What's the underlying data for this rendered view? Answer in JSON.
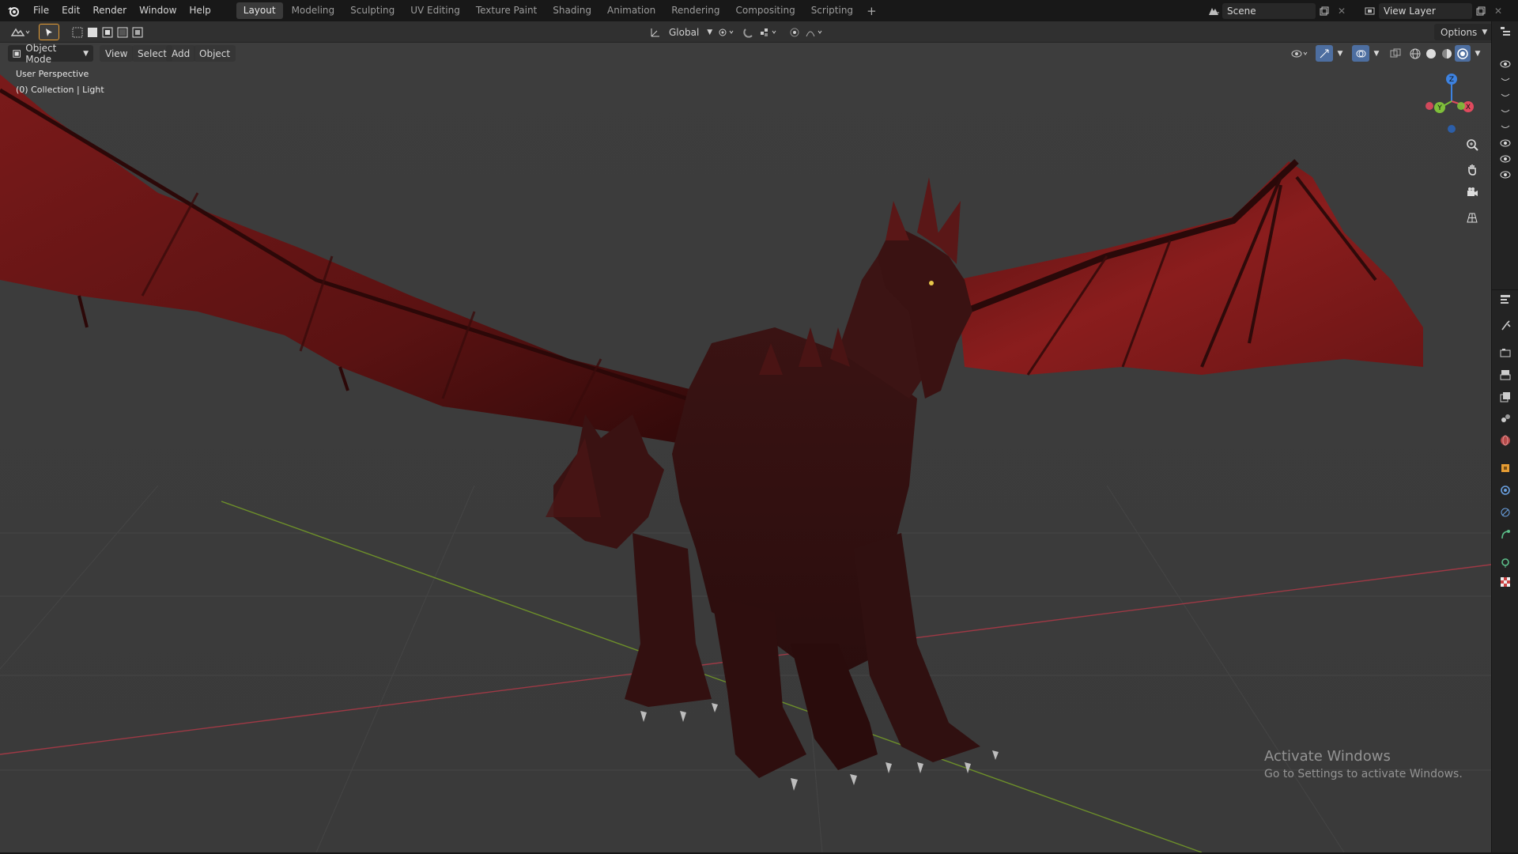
{
  "menu": [
    "File",
    "Edit",
    "Render",
    "Window",
    "Help"
  ],
  "workspaces": [
    "Layout",
    "Modeling",
    "Sculpting",
    "UV Editing",
    "Texture Paint",
    "Shading",
    "Animation",
    "Rendering",
    "Compositing",
    "Scripting"
  ],
  "active_workspace": "Layout",
  "add_workspace_label": "+",
  "scene": {
    "name": "Scene"
  },
  "view_layer": {
    "name": "View Layer"
  },
  "tool_header": {
    "transform_orientation": "Global",
    "options_label": "Options"
  },
  "viewport": {
    "mode": "Object Mode",
    "menus": [
      "View",
      "Select",
      "Add",
      "Object"
    ],
    "overlay_line1": "User Perspective",
    "overlay_line2": "(0) Collection | Light",
    "gizmo_axes": {
      "z": "Z",
      "y": "Y",
      "x": "X"
    }
  },
  "watermark": {
    "title": "Activate Windows",
    "subtitle": "Go to Settings to activate Windows."
  },
  "colors": {
    "accent_orange": "#e59c33",
    "axis_x": "#e04a5e",
    "axis_y": "#7fbf3a",
    "axis_z": "#3d82e0",
    "dragon_red": "#6b1414"
  },
  "right_strip_icons": [
    "outliner-icon",
    "eye-icon",
    "collapse-icon",
    "collapse-icon",
    "collapse-icon",
    "collapse-icon",
    "eye-icon",
    "eye-icon",
    "eye-icon",
    "properties-icon",
    "tool-icon",
    "render-icon",
    "output-icon",
    "view-layer-icon",
    "scene-icon",
    "world-icon",
    "object-icon",
    "modifier-icon",
    "physics-icon",
    "constraint-icon",
    "data-icon",
    "texture-icon"
  ]
}
